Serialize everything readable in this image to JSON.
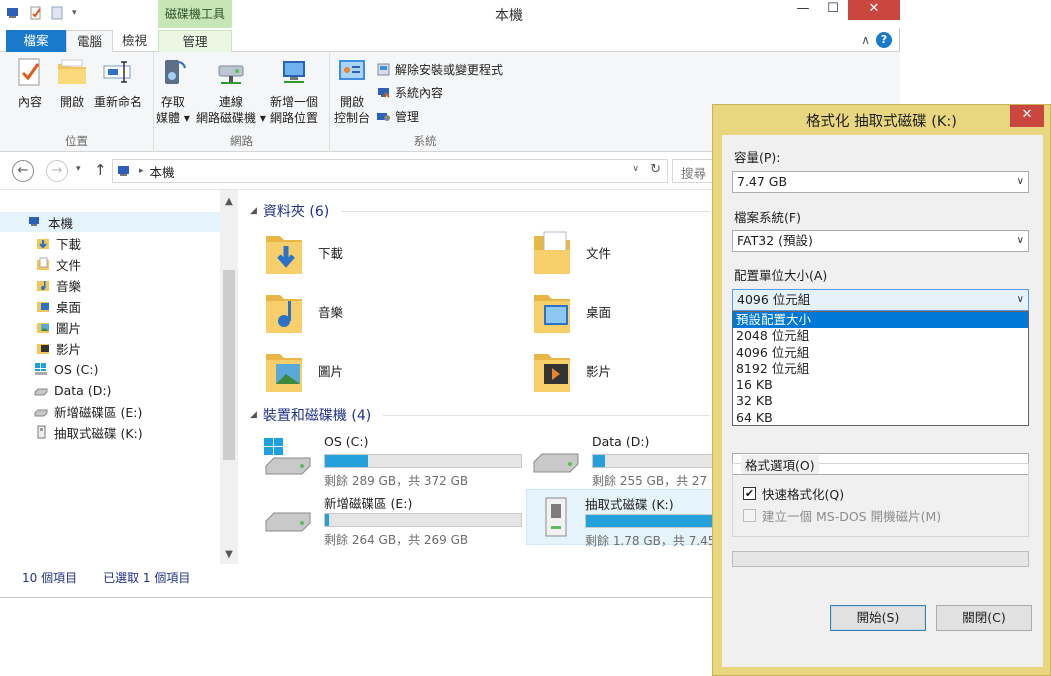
{
  "explorer": {
    "title": "本機",
    "context_tab_header": "磁碟機工具",
    "tabs": {
      "file": "檔案",
      "computer": "電腦",
      "view": "檢視",
      "manage": "管理"
    },
    "ribbon": {
      "location_group": {
        "label": "位置",
        "properties": "內容",
        "open": "開啟",
        "rename": "重新命名"
      },
      "network_group": {
        "label": "網路",
        "media_l1": "存取",
        "media_l2": "媒體",
        "map_l1": "連線",
        "map_l2": "網路磁碟機",
        "add_l1": "新增一個",
        "add_l2": "網路位置"
      },
      "system_group": {
        "label": "系統",
        "cp_l1": "開啟",
        "cp_l2": "控制台",
        "uninstall": "解除安裝或變更程式",
        "sysprops": "系統內容",
        "manage": "管理"
      }
    },
    "address": {
      "path": "本機",
      "search_placeholder": "搜尋"
    },
    "nav": [
      {
        "label": "本機"
      },
      {
        "label": "下載"
      },
      {
        "label": "文件"
      },
      {
        "label": "音樂"
      },
      {
        "label": "桌面"
      },
      {
        "label": "圖片"
      },
      {
        "label": "影片"
      },
      {
        "label": "OS (C:)"
      },
      {
        "label": "Data (D:)"
      },
      {
        "label": "新增磁碟區 (E:)"
      },
      {
        "label": "抽取式磁碟 (K:)"
      }
    ],
    "folders_header": "資料夾 (6)",
    "folders": [
      {
        "label": "下載"
      },
      {
        "label": "文件"
      },
      {
        "label": "音樂"
      },
      {
        "label": "桌面"
      },
      {
        "label": "圖片"
      },
      {
        "label": "影片"
      }
    ],
    "drives_header": "裝置和磁碟機 (4)",
    "drives": [
      {
        "name": "OS (C:)",
        "space": "剩餘 289 GB，共 372 GB",
        "used_fraction": 0.22
      },
      {
        "name": "Data (D:)",
        "space": "剩餘 255 GB，共 27",
        "used_fraction": 0.06
      },
      {
        "name": "新增磁碟區 (E:)",
        "space": "剩餘 264 GB，共 269 GB",
        "used_fraction": 0.02
      },
      {
        "name": "抽取式磁碟 (K:)",
        "space": "剩餘 1.78 GB，共 7.45",
        "used_fraction": 0.76
      }
    ],
    "status": {
      "items": "10 個項目",
      "selected": "已選取 1 個項目"
    }
  },
  "dialog": {
    "title": "格式化 抽取式磁碟 (K:)",
    "capacity_label": "容量(P):",
    "capacity_value": "7.47 GB",
    "fs_label": "檔案系統(F)",
    "fs_value": "FAT32 (預設)",
    "alloc_label": "配置單位大小(A)",
    "alloc_value": "4096 位元組",
    "alloc_options": [
      "預設配置大小",
      "2048 位元組",
      "4096 位元組",
      "8192 位元組",
      "16 KB",
      "32 KB",
      "64 KB"
    ],
    "options_legend": "格式選項(O)",
    "quick_format": "快速格式化(Q)",
    "msdos": "建立一個 MS-DOS 開機磁片(M)",
    "start": "開始(S)",
    "close": "關閉(C)"
  },
  "colors": {
    "accent": "#1979ca",
    "dialog_frame": "#e9d780",
    "selection": "#0078d7",
    "drive_bar": "#26a0da",
    "close_red": "#c9473e"
  }
}
